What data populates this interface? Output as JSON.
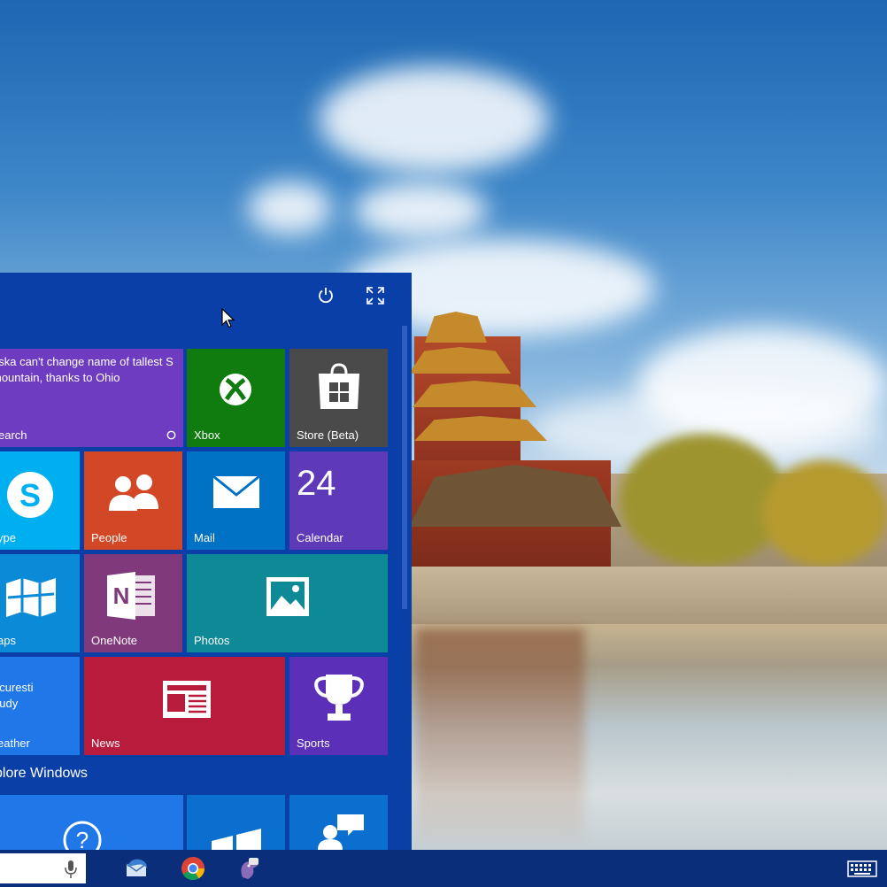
{
  "start_menu": {
    "header": {
      "power_icon": "power-icon",
      "expand_icon": "expand-icon"
    },
    "tiles": {
      "news_feed": {
        "headline": "aska can't change name of tallest S mountain, thanks to Ohio",
        "label": "earch",
        "color": "#6e3cc0"
      },
      "xbox": {
        "label": "Xbox",
        "color": "#107c10"
      },
      "store": {
        "label": "Store (Beta)",
        "color": "#4a4a4a"
      },
      "skype": {
        "label": "ype",
        "color": "#00aff0"
      },
      "people": {
        "label": "People",
        "color": "#d24726"
      },
      "mail": {
        "label": "Mail",
        "color": "#0072c6"
      },
      "calendar": {
        "label": "Calendar",
        "number": "24",
        "color": "#5f3ab8"
      },
      "maps": {
        "label": "aps",
        "color": "#0b8ad8"
      },
      "onenote": {
        "label": "OneNote",
        "color": "#80397b"
      },
      "photos": {
        "label": "Photos",
        "color": "#0e8a96"
      },
      "weather": {
        "label": "eather",
        "line1": "ucuresti",
        "line2": "oudy",
        "color": "#1f77e8"
      },
      "news": {
        "label": "News",
        "color": "#b81b3c"
      },
      "sports": {
        "label": "Sports",
        "color": "#5b2fb8"
      }
    },
    "explore_section": {
      "title": "plore Windows"
    }
  },
  "taskbar": {
    "apps": [
      "thunderbird-icon",
      "chrome-icon",
      "pidgin-icon"
    ],
    "keyboard_icon": "keyboard-icon"
  }
}
